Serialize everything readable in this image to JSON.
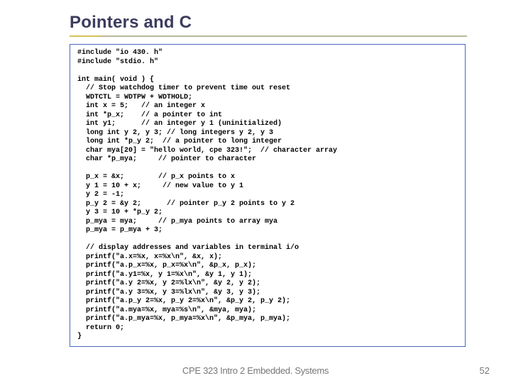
{
  "slide": {
    "title": "Pointers and C",
    "footer": "CPE 323 Intro 2 Embedded. Systems",
    "page_number": "52"
  },
  "code": {
    "lines": [
      "#include \"io 430. h\"",
      "#include \"stdio. h\"",
      "",
      "int main( void ) {",
      "  // Stop watchdog timer to prevent time out reset",
      "  WDTCTL = WDTPW + WDTHOLD;",
      "  int x = 5;   // an integer x",
      "  int *p_x;    // a pointer to int",
      "  int y1;      // an integer y 1 (uninitialized)",
      "  long int y 2, y 3; // long integers y 2, y 3",
      "  long int *p_y 2;  // a pointer to long integer",
      "  char mya[20] = \"hello world, cpe 323!\";  // character array",
      "  char *p_mya;     // pointer to character",
      "",
      "  p_x = &x;        // p_x points to x",
      "  y 1 = 10 + x;     // new value to y 1",
      "  y 2 = -1;",
      "  p_y 2 = &y 2;      // pointer p_y 2 points to y 2",
      "  y 3 = 10 + *p_y 2;",
      "  p_mya = mya;     // p_mya points to array mya",
      "  p_mya = p_mya + 3;",
      "",
      "  // display addresses and variables in terminal i/o",
      "  printf(\"a.x=%x, x=%x\\n\", &x, x);",
      "  printf(\"a.p_x=%x, p_x=%x\\n\", &p_x, p_x);",
      "  printf(\"a.y1=%x, y 1=%x\\n\", &y 1, y 1);",
      "  printf(\"a.y 2=%x, y 2=%lx\\n\", &y 2, y 2);",
      "  printf(\"a.y 3=%x, y 3=%lx\\n\", &y 3, y 3);",
      "  printf(\"a.p_y 2=%x, p_y 2=%x\\n\", &p_y 2, p_y 2);",
      "  printf(\"a.mya=%x, mya=%s\\n\", &mya, mya);",
      "  printf(\"a.p_mya=%x, p_mya=%x\\n\", &p_mya, p_mya);",
      "  return 0;",
      "}"
    ]
  }
}
